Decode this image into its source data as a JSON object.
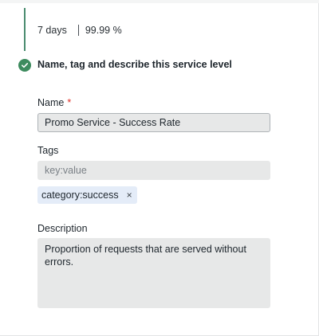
{
  "summary": {
    "period": "7 days",
    "target": "99.99 %"
  },
  "step": {
    "title": "Name, tag and describe this service level",
    "status_icon": "check-circle-icon"
  },
  "form": {
    "name": {
      "label": "Name",
      "required_marker": "*",
      "value": "Promo Service - Success Rate"
    },
    "tags": {
      "label": "Tags",
      "placeholder": "key:value",
      "chips": [
        {
          "text": "category:success",
          "remove_icon": "close-icon",
          "remove_glyph": "×"
        }
      ]
    },
    "description": {
      "label": "Description",
      "value": "Proportion of requests that are served without errors."
    }
  },
  "colors": {
    "accent_green": "#3d8b5e",
    "required_red": "#df2d24",
    "chip_bg": "#e4ecf8"
  }
}
